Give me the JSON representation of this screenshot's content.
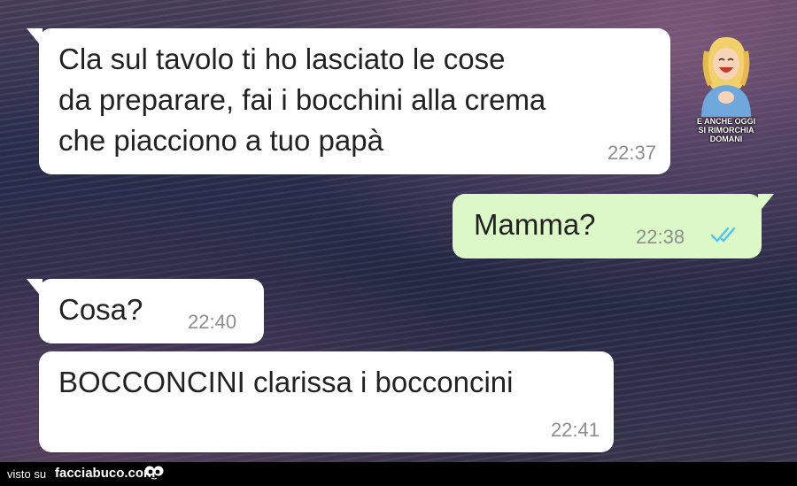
{
  "chat": {
    "messages": [
      {
        "direction": "incoming",
        "text": "Cla sul tavolo ti ho lasciato le cose\nda preparare, fai i bocchini alla crema\nche piacciono a tuo papà",
        "time": "22:37"
      },
      {
        "direction": "outgoing",
        "text": "Mamma?",
        "time": "22:38",
        "status": "read",
        "status_icon": "double-check-icon"
      },
      {
        "direction": "incoming",
        "text": "Cosa?",
        "time": "22:40"
      },
      {
        "direction": "incoming",
        "text": "BOCCONCINI clarissa i bocconcini",
        "time": "22:41"
      }
    ]
  },
  "sticker": {
    "caption_line1": "E ANCHE OGGI",
    "caption_line2": "SI RIMORCHIA DOMANI"
  },
  "footer": {
    "prefix": "visto su",
    "site": "facciabuco.com"
  },
  "colors": {
    "incoming_bubble": "#ffffff",
    "outgoing_bubble": "#dcf8c6",
    "read_ticks": "#4fc3f7",
    "timestamp": "#8e8e8e"
  }
}
